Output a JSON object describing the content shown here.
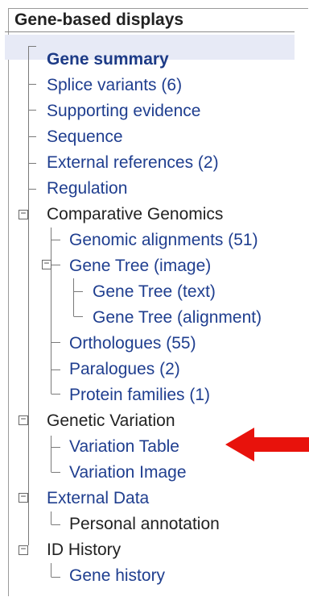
{
  "header": {
    "title": "Gene-based displays"
  },
  "items": {
    "gene_summary": "Gene summary",
    "splice_variants": "Splice variants (6)",
    "supporting_evidence": "Supporting evidence",
    "sequence": "Sequence",
    "external_references": "External references (2)",
    "regulation": "Regulation",
    "comparative_genomics": "Comparative Genomics",
    "genomic_alignments": "Genomic alignments (51)",
    "gene_tree_image": "Gene Tree (image)",
    "gene_tree_text": "Gene Tree (text)",
    "gene_tree_alignment": "Gene Tree (alignment)",
    "orthologues": "Orthologues (55)",
    "paralogues": "Paralogues (2)",
    "protein_families": "Protein families (1)",
    "genetic_variation": "Genetic Variation",
    "variation_table": "Variation Table",
    "variation_image": "Variation Image",
    "external_data": "External Data",
    "personal_annotation": "Personal annotation",
    "id_history": "ID History",
    "gene_history": "Gene history"
  },
  "colors": {
    "link": "#1f3e8f",
    "active_background": "#e7eaf6",
    "annotation_arrow": "#e8120c"
  },
  "icons": {
    "expander": "minus-square-icon",
    "annotation": "red-arrow-left-icon"
  },
  "expander_symbol": "−"
}
